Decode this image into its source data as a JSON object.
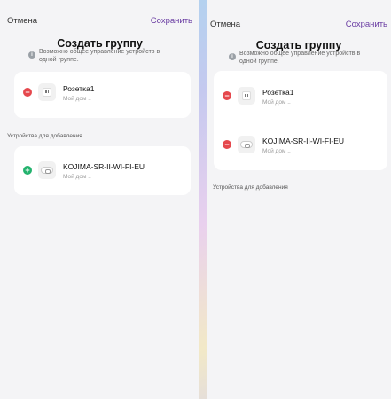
{
  "left": {
    "cancel": "Отмена",
    "save": "Сохранить",
    "title": "Создать группу",
    "hint": "Возможно общее управление устройств в одной группе.",
    "group_devices": [
      {
        "name": "Розетка1",
        "room": "Мой дом ..",
        "icon": "socket-icon",
        "action": "remove"
      }
    ],
    "section_label": "Устройства для добавления",
    "available_devices": [
      {
        "name": "KOJIMA-SR-II-WI-FI-EU",
        "room": "Мой дом ..",
        "icon": "plug-icon",
        "action": "add"
      }
    ]
  },
  "right": {
    "cancel": "Отмена",
    "save": "Сохранить",
    "title": "Создать группу",
    "hint": "Возможно общее управление устройств в одной группе.",
    "group_devices": [
      {
        "name": "Розетка1",
        "room": "Мой дом ..",
        "icon": "socket-icon",
        "action": "remove"
      },
      {
        "name": "KOJIMA-SR-II-WI-FI-EU",
        "room": "Мой дом ..",
        "icon": "plug-icon",
        "action": "remove"
      }
    ],
    "section_label": "Устройства для добавления",
    "available_devices": []
  },
  "colors": {
    "accent": "#6b3ea3",
    "remove": "#e5484d",
    "add": "#23b26d",
    "background": "#f4f4f6"
  }
}
